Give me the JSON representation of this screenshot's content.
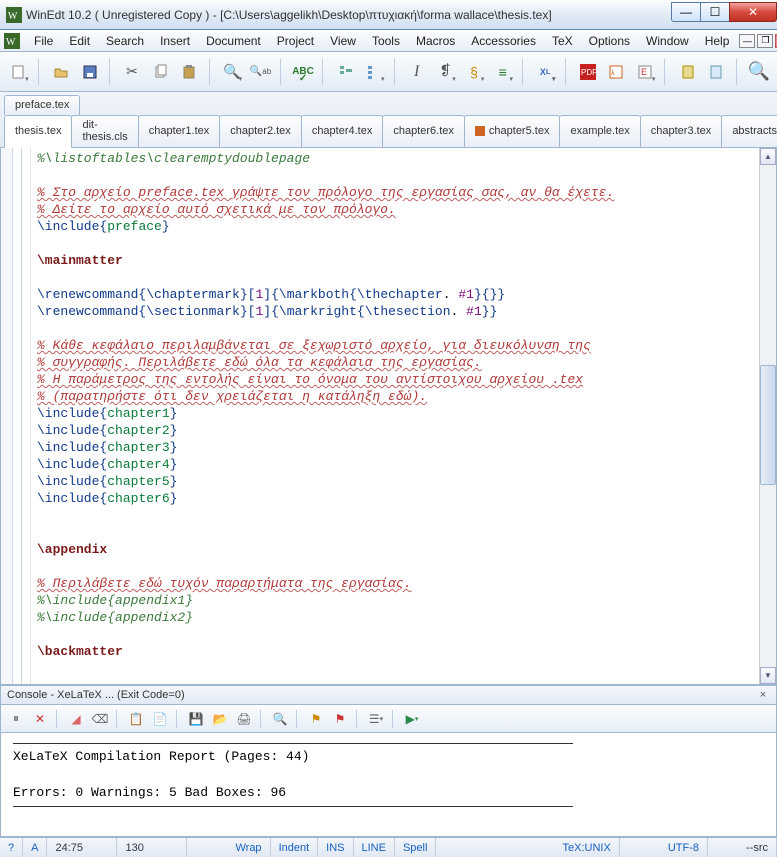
{
  "window": {
    "title": "WinEdt 10.2  ( Unregistered  Copy )   -  [C:\\Users\\aggelikh\\Desktop\\πτυχιακή\\forma wallace\\thesis.tex]"
  },
  "menu": {
    "items": [
      "File",
      "Edit",
      "Search",
      "Insert",
      "Document",
      "Project",
      "View",
      "Tools",
      "Macros",
      "Accessories",
      "TeX",
      "Options",
      "Window",
      "Help"
    ]
  },
  "tabs": {
    "row1": [
      "preface.tex"
    ],
    "row2": [
      "thesis.tex",
      "dit-thesis.cls",
      "chapter1.tex",
      "chapter2.tex",
      "chapter4.tex",
      "chapter6.tex",
      "chapter5.tex",
      "example.tex",
      "chapter3.tex",
      "abstracts.tex"
    ],
    "active": "thesis.tex",
    "iconed": "chapter5.tex"
  },
  "code": {
    "l1a": "%\\listoftables\\clearemptydoublepage",
    "l3": "% Στο αρχείο preface.tex γράψτε τον πρόλογο της εργασίας σας, αν θα έχετε.",
    "l4": "% Δείτε το αρχείο αυτό σχετικά με τον πρόλογο.",
    "l5a": "\\include",
    "l5b": "{",
    "l5c": "preface",
    "l5d": "}",
    "l7": "\\mainmatter",
    "l9a": "\\renewcommand",
    "l9b": "{",
    "l9c": "\\chaptermark",
    "l9d": "}[",
    "l9e": "1",
    "l9f": "]{",
    "l9g": "\\markboth",
    "l9h": "{",
    "l9i": "\\thechapter",
    "l9j": ". ",
    "l9k": "#1",
    "l9l": "}{}}",
    "l10a": "\\renewcommand",
    "l10b": "{",
    "l10c": "\\sectionmark",
    "l10d": "}[",
    "l10e": "1",
    "l10f": "]{",
    "l10g": "\\markright",
    "l10h": "{",
    "l10i": "\\thesection",
    "l10j": ". ",
    "l10k": "#1",
    "l10l": "}}",
    "l12": "% Κάθε κεφάλαιο περιλαμβάνεται σε ξεχωριστό αρχείο, για διευκόλυνση της",
    "l13": "% συγγραφής. Περιλάβετε εδώ όλα τα κεφάλαια της εργασίας.",
    "l14": "% Η παράμετρος της εντολής είναι το όνομα του αντίστοιχου αρχείου .tex",
    "l15": "% (παρατηρήστε ότι δεν χρειάζεται η κατάληξη εδώ).",
    "inc": "\\include",
    "ob": "{",
    "cb": "}",
    "ch1": "chapter1",
    "ch2": "chapter2",
    "ch3": "chapter3",
    "ch4": "chapter4",
    "ch5": "chapter5",
    "ch6": "chapter6",
    "l23": "\\appendix",
    "l25": "% Περιλάβετε εδώ τυχόν παραρτήματα της εργασίας.",
    "l26": "%\\include{appendix1}",
    "l27": "%\\include{appendix2}",
    "l29": "\\backmatter"
  },
  "console": {
    "title": "Console - XeLaTeX ... (Exit Code=0)",
    "report": "XeLaTeX Compilation Report (Pages: 44)",
    "stats": "Errors: 0   Warnings: 5   Bad Boxes: 96"
  },
  "status": {
    "q": "?",
    "a": "A",
    "pos": "24:75",
    "col": "130",
    "items": [
      "Wrap",
      "Indent",
      "INS",
      "LINE",
      "Spell"
    ],
    "tex": "TeX:UNIX",
    "enc": "UTF-8",
    "src": "--src"
  }
}
